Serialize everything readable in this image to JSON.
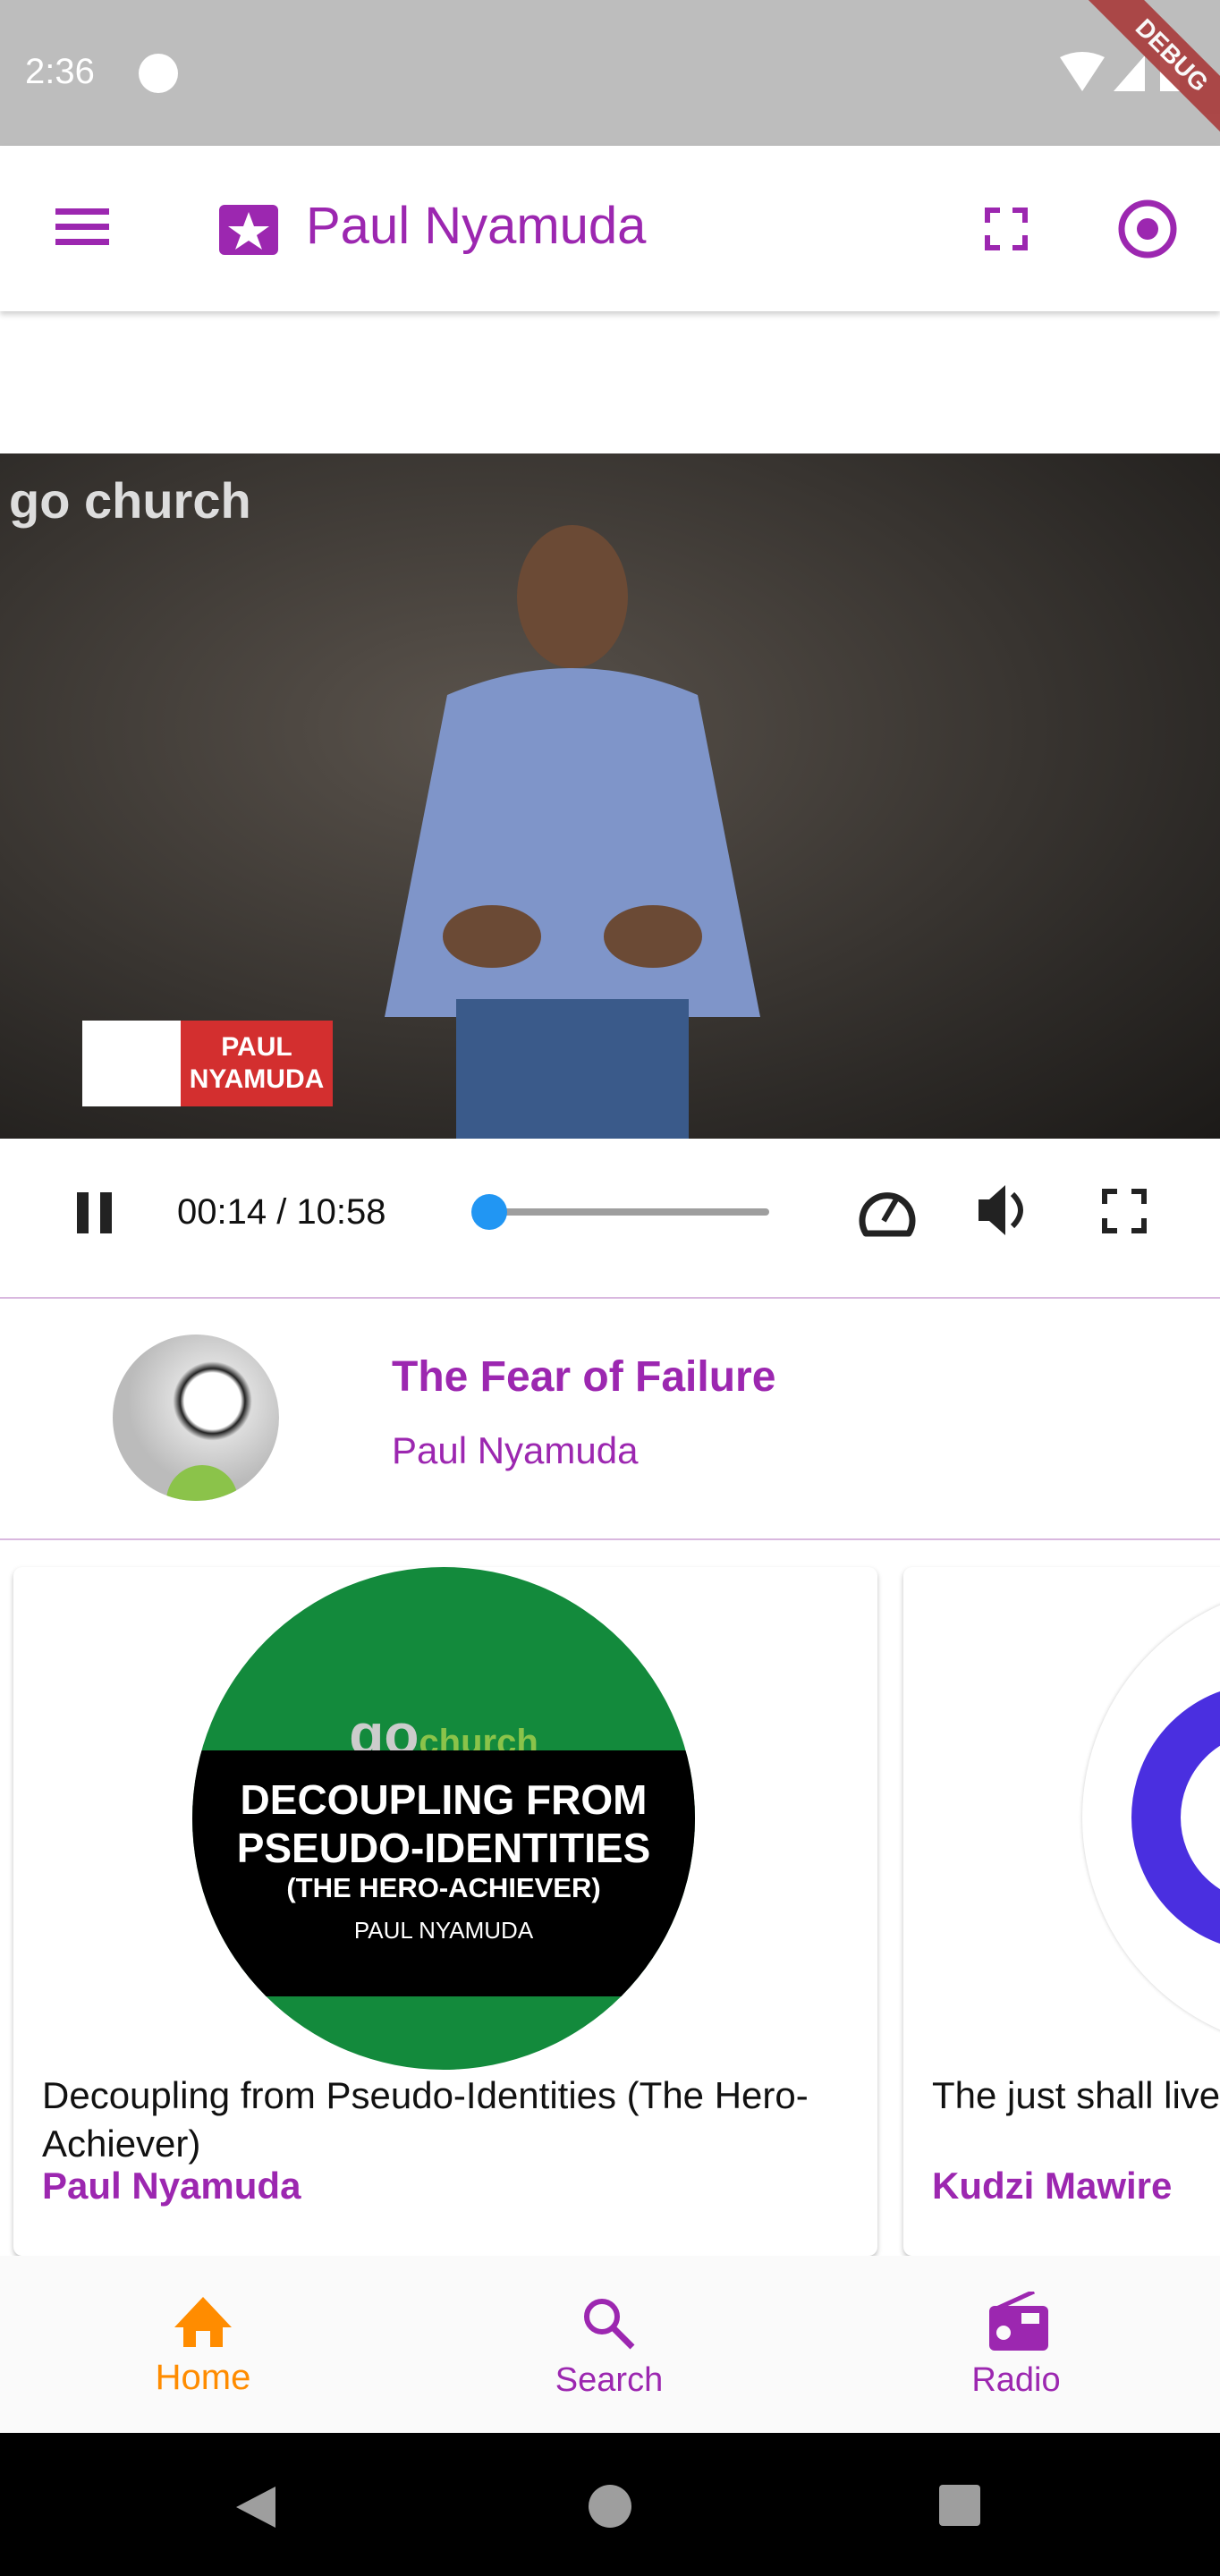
{
  "status_bar": {
    "time": "2:36",
    "debug_banner": "DEBUG"
  },
  "app_bar": {
    "title": "Paul Nyamuda"
  },
  "video": {
    "overlay_logo": "go church",
    "lower_third": "PAUL NYAMUDA"
  },
  "player": {
    "position": "00:14",
    "duration": "10:58",
    "time_display": "00:14 / 10:58",
    "progress_fraction": 0.021,
    "accent": "#2196f3"
  },
  "now_playing": {
    "title": "The Fear of Failure",
    "artist": "Paul Nyamuda"
  },
  "cards": [
    {
      "title": "Decoupling from Pseudo-Identities (The Hero-Achiever)",
      "artist": "Paul Nyamuda",
      "artwork_lines": [
        "DECOUPLING FROM",
        "PSEUDO-IDENTITIES",
        "(THE HERO-ACHIEVER)",
        "PAUL NYAMUDA"
      ]
    },
    {
      "title": "The just shall live by faith Fear or faith",
      "artist": "Kudzi Mawire"
    }
  ],
  "bottom_nav": {
    "items": [
      {
        "label": "Home",
        "active": true
      },
      {
        "label": "Search"
      },
      {
        "label": "Radio"
      }
    ],
    "active_color": "#ff8c00",
    "color": "#9c27b0"
  }
}
